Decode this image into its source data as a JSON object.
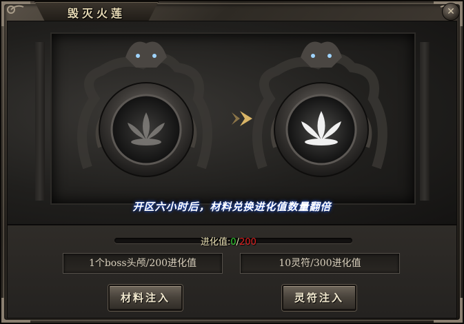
{
  "window": {
    "title": "毁灭火莲",
    "close_glyph": "✕"
  },
  "banner": {
    "notice": "开区六小时后，材料兑换进化值数量翻倍"
  },
  "progress": {
    "label": "进化值:",
    "current": "0",
    "separator": "/",
    "max": "200",
    "fraction": 0
  },
  "exchange": {
    "material_info": "1个boss头颅/200进化值",
    "rune_info": "10灵符/300进化值",
    "material_button": "材料注入",
    "rune_button": "灵符注入"
  },
  "colors": {
    "current_value": "#2fd22f",
    "max_value": "#e02020",
    "notice_glow": "#2a5bd6"
  },
  "icons": [
    "lotus-icon",
    "arrow-right-icon",
    "close-icon"
  ]
}
